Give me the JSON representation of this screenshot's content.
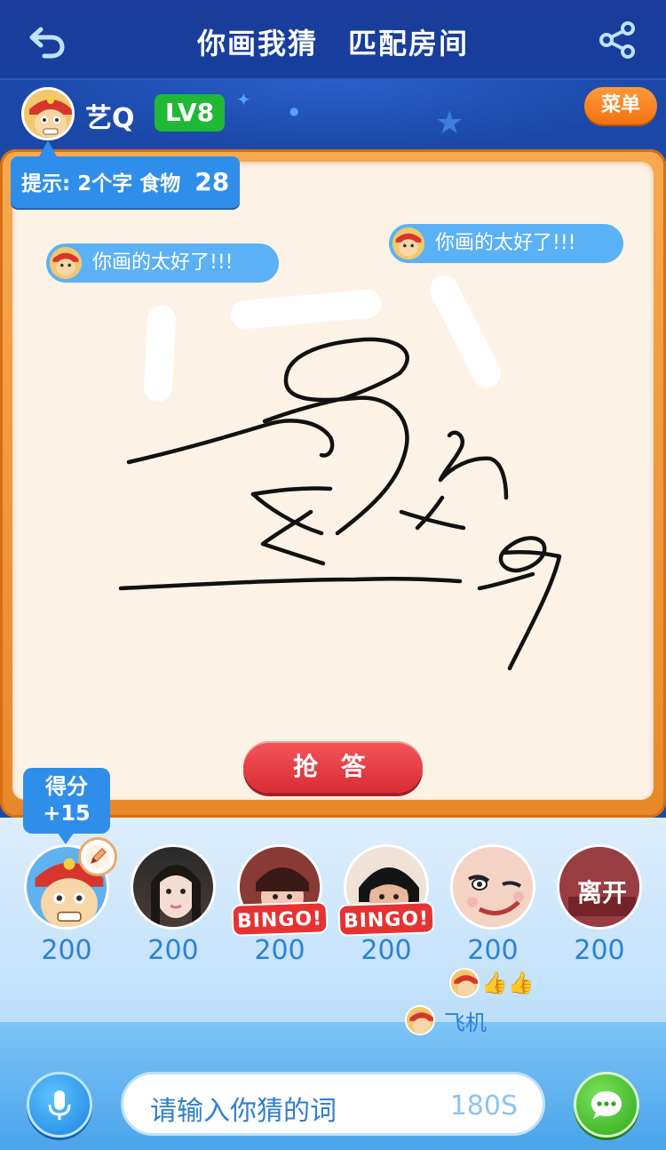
{
  "header": {
    "title": "你画我猜　匹配房间",
    "back_icon": "back-arrow-icon",
    "share_icon": "share-icon"
  },
  "player": {
    "name": "艺Q",
    "level": "LV8",
    "menu_label": "菜单"
  },
  "hint": {
    "text": "提示: 2个字 食物",
    "countdown": "28"
  },
  "chat": [
    {
      "text": "你画的太好了!!!"
    },
    {
      "text": "你画的太好了!!!"
    }
  ],
  "answer_button": "抢 答",
  "score_popup": {
    "line1": "得分",
    "line2": "+15"
  },
  "players": [
    {
      "score": "200",
      "badge": ""
    },
    {
      "score": "200",
      "badge": ""
    },
    {
      "score": "200",
      "badge": "BINGO!"
    },
    {
      "score": "200",
      "badge": "BINGO!"
    },
    {
      "score": "200",
      "badge": ""
    },
    {
      "score": "200",
      "badge": "",
      "overlay": "离开"
    }
  ],
  "reactions": {
    "thumbs": "👍👍",
    "gift_text": "飞机"
  },
  "input": {
    "placeholder": "请输入你猜的词",
    "timer": "180S"
  },
  "colors": {
    "header_bg": "#1a3c9a",
    "accent_blue": "#2f8eea",
    "level_green": "#1fb935",
    "menu_orange": "#f27210",
    "answer_red": "#d92c35",
    "board_bg": "#fdf2e6"
  }
}
